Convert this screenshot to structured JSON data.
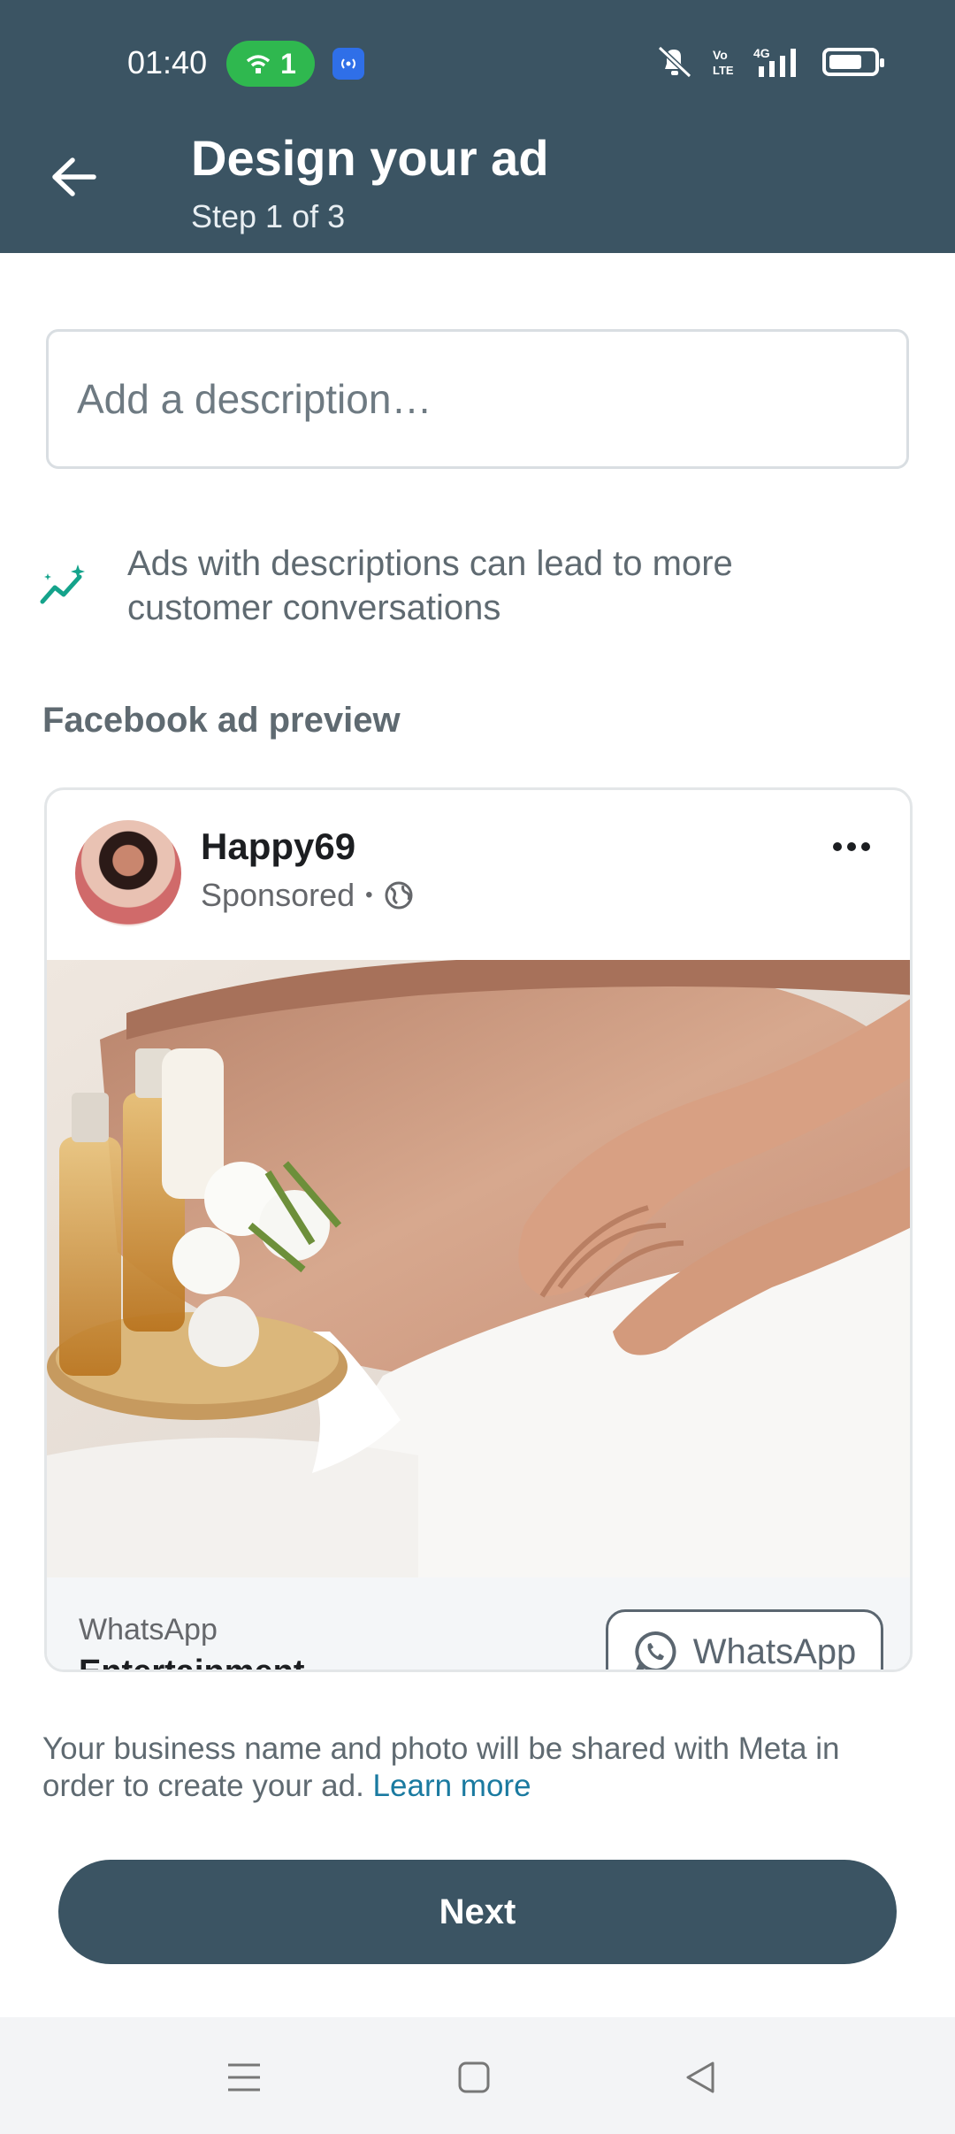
{
  "status_bar": {
    "time": "01:40",
    "hotspot_count": "1",
    "network": "4G",
    "volte": "Vo LTE",
    "battery_level": 0.75
  },
  "header": {
    "title": "Design your ad",
    "subtitle": "Step 1 of 3"
  },
  "description": {
    "placeholder": "Add a description…",
    "value": ""
  },
  "tip": {
    "text": "Ads with descriptions can lead to more customer conversations"
  },
  "preview": {
    "section_title": "Facebook ad preview",
    "business_name": "Happy69",
    "sponsored_label": "Sponsored",
    "footer_app": "WhatsApp",
    "footer_category": "Entertainment",
    "cta_label": "WhatsApp"
  },
  "consent": {
    "text": "Your business name and photo will be shared with Meta in order to create your ad.",
    "link": "Learn more"
  },
  "next_button": {
    "label": "Next"
  },
  "colors": {
    "header_bg": "#3b5463",
    "accent_link": "#1a7aa0",
    "tip_icon": "#14a38b",
    "hotspot_green": "#2fb84f"
  }
}
